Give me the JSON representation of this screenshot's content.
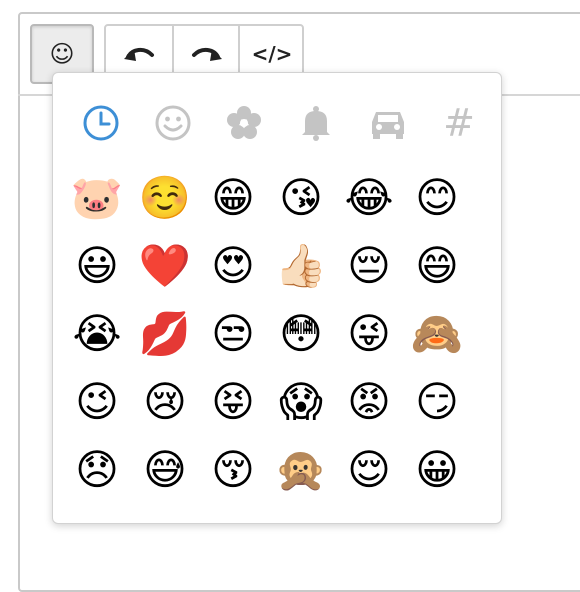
{
  "toolbar": {
    "emoji_button_glyph": "☺",
    "undo_icon": "undo-icon",
    "redo_icon": "redo-icon",
    "code_label": "</>"
  },
  "colors": {
    "active_category": "#3d8fd6",
    "inactive_category": "#c4c4c4"
  },
  "categories": [
    {
      "icon": "recent-clock-icon",
      "active": true
    },
    {
      "icon": "smiley-icon",
      "active": false
    },
    {
      "icon": "flower-icon",
      "active": false
    },
    {
      "icon": "bell-icon",
      "active": false
    },
    {
      "icon": "car-icon",
      "active": false
    },
    {
      "icon": "symbols-hash-icon",
      "active": false,
      "glyph": "#"
    }
  ],
  "emojis": [
    [
      "🐷",
      "☺️",
      "😁",
      "😘",
      "😂",
      "😊"
    ],
    [
      "😃",
      "❤️",
      "😍",
      "👍🏻",
      "😔",
      "😄"
    ],
    [
      "😭",
      "💋",
      "😒",
      "😳",
      "😜",
      "🙈"
    ],
    [
      "😉",
      "😢",
      "😝",
      "😱",
      "😡",
      "😏"
    ],
    [
      "😞",
      "😅",
      "😚",
      "🙊",
      "😌",
      "😀"
    ]
  ]
}
